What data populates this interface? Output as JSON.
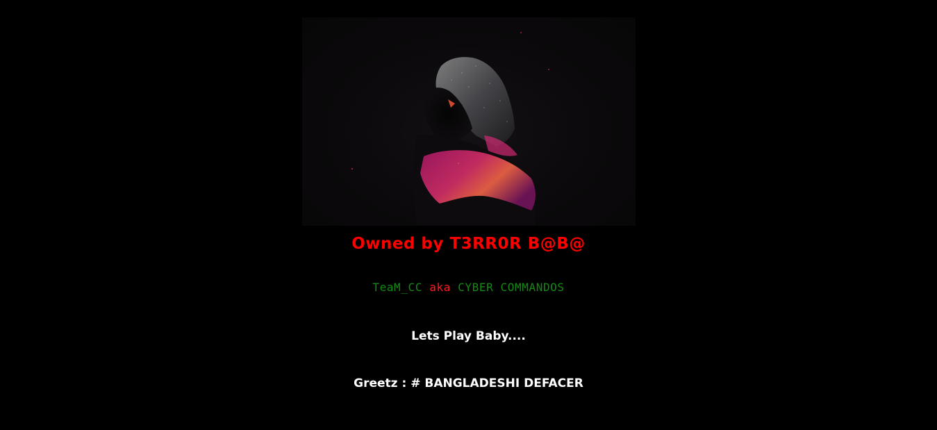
{
  "hero": {
    "icon": "hooded-figure-image"
  },
  "title": {
    "text": "Owned by T3RR0R B@B@"
  },
  "team": {
    "name": "TeaM_CC",
    "connector": "aka",
    "alias": "CYBER COMMANDOS"
  },
  "tagline": {
    "text": "Lets Play Baby...."
  },
  "greetz": {
    "text": "Greetz : # BANGLADESHI DEFACER"
  },
  "colors": {
    "background": "#000000",
    "title": "#ff0000",
    "team_name": "#138a13",
    "connector": "#ff1a1a",
    "white_text": "#ffffff"
  }
}
